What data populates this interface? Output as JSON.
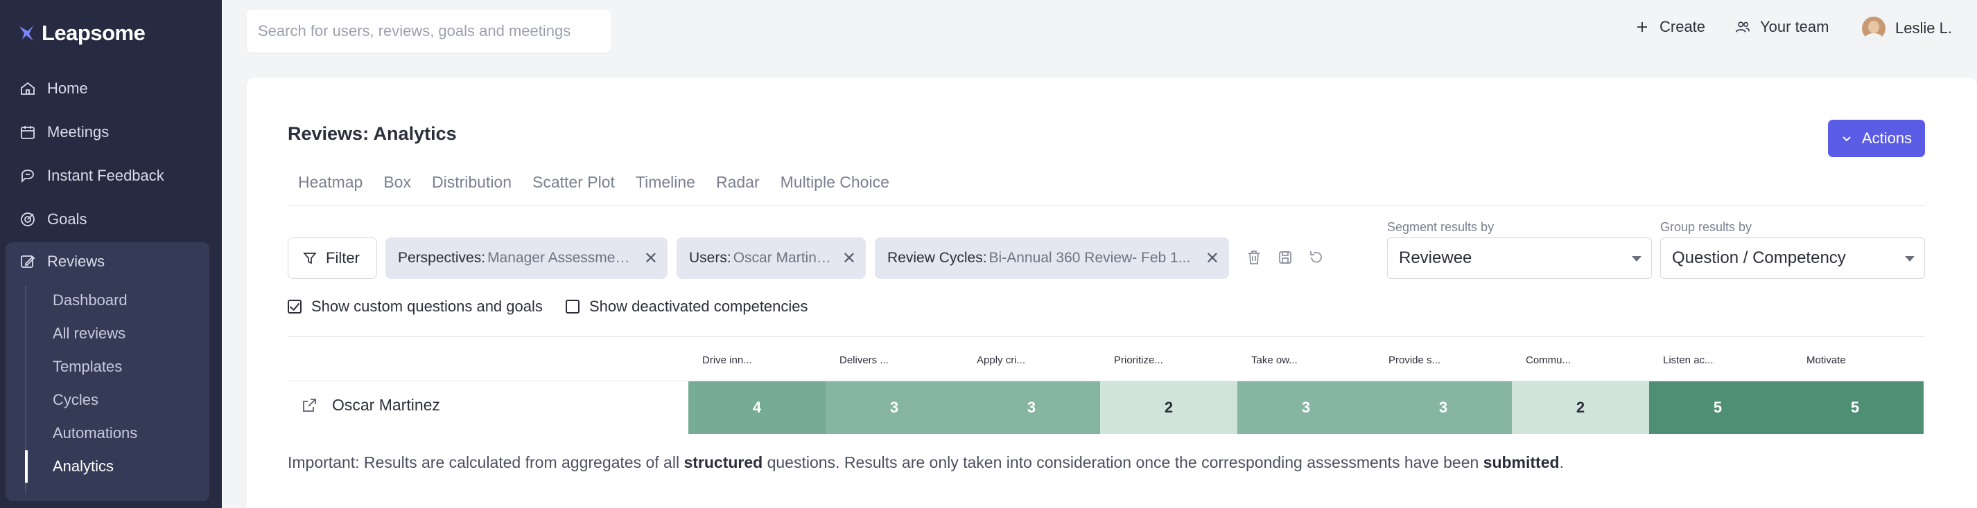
{
  "app": {
    "name": "Leapsome"
  },
  "sidebar": {
    "items": [
      {
        "label": "Home",
        "icon": "home-icon"
      },
      {
        "label": "Meetings",
        "icon": "meetings-icon"
      },
      {
        "label": "Instant Feedback",
        "icon": "feedback-icon"
      },
      {
        "label": "Goals",
        "icon": "goals-icon"
      }
    ],
    "reviews": {
      "label": "Reviews",
      "icon": "reviews-icon",
      "sub_items": [
        "Dashboard",
        "All reviews",
        "Templates",
        "Cycles",
        "Automations",
        "Analytics"
      ],
      "active_sub": "Analytics"
    }
  },
  "topbar": {
    "search_placeholder": "Search for users, reviews, goals and meetings",
    "create_label": "Create",
    "team_label": "Your team",
    "user_name": "Leslie L."
  },
  "main": {
    "title": "Reviews: Analytics",
    "actions_label": "Actions",
    "tabs": [
      "Heatmap",
      "Box",
      "Distribution",
      "Scatter Plot",
      "Timeline",
      "Radar",
      "Multiple Choice"
    ],
    "filter_label": "Filter",
    "chips": [
      {
        "key": "Perspectives:",
        "value": "Manager Assessments"
      },
      {
        "key": "Users:",
        "value": "Oscar Martinez"
      },
      {
        "key": "Review Cycles:",
        "value": "Bi-Annual 360 Review- Feb 1..."
      }
    ],
    "segment": {
      "label": "Segment results by",
      "value": "Reviewee"
    },
    "group": {
      "label": "Group results by",
      "value": "Question / Competency"
    },
    "checkboxes": [
      {
        "label": "Show custom questions and goals",
        "checked": true
      },
      {
        "label": "Show deactivated competencies",
        "checked": false
      }
    ]
  },
  "heatmap": {
    "columns": [
      "Drive inn...",
      "Delivers ...",
      "Apply cri...",
      "Prioritize...",
      "Take ow...",
      "Provide s...",
      "Commu...",
      "Listen ac...",
      "Motivate"
    ],
    "rows": [
      {
        "name": "Oscar Martinez",
        "values": [
          "4",
          "3",
          "3",
          "2",
          "3",
          "3",
          "2",
          "5",
          "5"
        ]
      }
    ],
    "colors": {
      "2": "#d1e4db",
      "3": "#86b5a1",
      "4": "#76ab95",
      "5": "#4f8f73"
    }
  },
  "note": {
    "part1": "Important: Results are calculated from aggregates of all ",
    "bold1": "structured",
    "part2": " questions. Results are only taken into consideration once the corresponding assessments have been ",
    "bold2": "submitted",
    "part3": "."
  }
}
